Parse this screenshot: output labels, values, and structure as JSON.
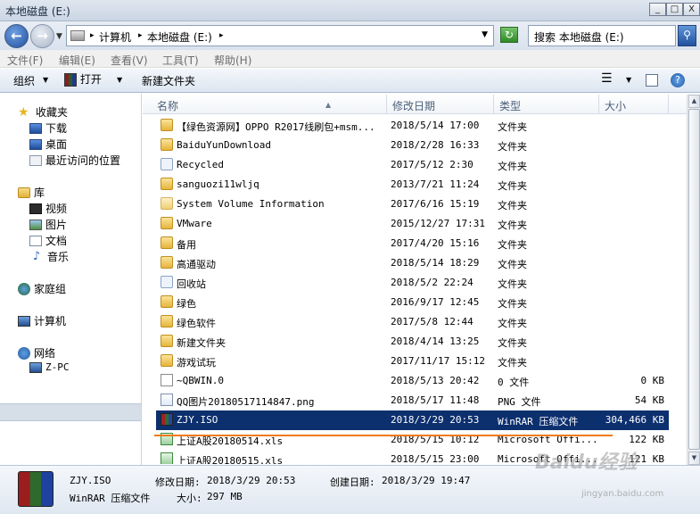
{
  "window": {
    "title": "本地磁盘 (E:)",
    "min": "_",
    "max": "□",
    "close": "X"
  },
  "address": {
    "crumbs": [
      "计算机",
      "本地磁盘 (E:)"
    ],
    "sep": "▸",
    "search_placeholder": "搜索 本地磁盘 (E:)"
  },
  "menu": [
    "文件(F)",
    "编辑(E)",
    "查看(V)",
    "工具(T)",
    "帮助(H)"
  ],
  "toolbar": {
    "organize": "组织",
    "open": "打开",
    "new_folder": "新建文件夹"
  },
  "nav": {
    "favorites": "收藏夹",
    "fav_items": [
      "下载",
      "桌面",
      "最近访问的位置"
    ],
    "libraries": "库",
    "lib_items": [
      "视频",
      "图片",
      "文档",
      "音乐"
    ],
    "homegroup": "家庭组",
    "computer": "计算机",
    "network": "网络",
    "network_items": [
      "Z-PC"
    ]
  },
  "columns": {
    "name": "名称",
    "modified": "修改日期",
    "type": "类型",
    "size": "大小"
  },
  "files": [
    {
      "name": "【绿色资源网】OPPO R2017线刷包+msm...",
      "date": "2018/5/14 17:00",
      "type": "文件夹",
      "size": "",
      "icon": "folder"
    },
    {
      "name": "BaiduYunDownload",
      "date": "2018/2/28 16:33",
      "type": "文件夹",
      "size": "",
      "icon": "folder"
    },
    {
      "name": "Recycled",
      "date": "2017/5/12 2:30",
      "type": "文件夹",
      "size": "",
      "icon": "recycle"
    },
    {
      "name": "sanguozi11wljq",
      "date": "2013/7/21 11:24",
      "type": "文件夹",
      "size": "",
      "icon": "folder"
    },
    {
      "name": "System Volume Information",
      "date": "2017/6/16 15:19",
      "type": "文件夹",
      "size": "",
      "icon": "folder-light"
    },
    {
      "name": "VMware",
      "date": "2015/12/27 17:31",
      "type": "文件夹",
      "size": "",
      "icon": "folder"
    },
    {
      "name": "备用",
      "date": "2017/4/20 15:16",
      "type": "文件夹",
      "size": "",
      "icon": "folder"
    },
    {
      "name": "高通驱动",
      "date": "2018/5/14 18:29",
      "type": "文件夹",
      "size": "",
      "icon": "folder"
    },
    {
      "name": "回收站",
      "date": "2018/5/2 22:24",
      "type": "文件夹",
      "size": "",
      "icon": "recycle"
    },
    {
      "name": "绿色",
      "date": "2016/9/17 12:45",
      "type": "文件夹",
      "size": "",
      "icon": "folder"
    },
    {
      "name": "绿色软件",
      "date": "2017/5/8 12:44",
      "type": "文件夹",
      "size": "",
      "icon": "folder"
    },
    {
      "name": "新建文件夹",
      "date": "2018/4/14 13:25",
      "type": "文件夹",
      "size": "",
      "icon": "folder"
    },
    {
      "name": "游戏试玩",
      "date": "2017/11/17 15:12",
      "type": "文件夹",
      "size": "",
      "icon": "folder"
    },
    {
      "name": "~QBWIN.0",
      "date": "2018/5/13 20:42",
      "type": "0 文件",
      "size": "0 KB",
      "icon": "file"
    },
    {
      "name": "QQ图片20180517114847.png",
      "date": "2018/5/17 11:48",
      "type": "PNG 文件",
      "size": "54 KB",
      "icon": "png"
    },
    {
      "name": "ZJY.ISO",
      "date": "2018/3/29 20:53",
      "type": "WinRAR 压缩文件",
      "size": "304,466 KB",
      "icon": "rar",
      "selected": true
    },
    {
      "name": "上证A股20180514.xls",
      "date": "2018/5/15 10:12",
      "type": "Microsoft Offi...",
      "size": "122 KB",
      "icon": "xls"
    },
    {
      "name": "上证A股20180515.xls",
      "date": "2018/5/15 23:00",
      "type": "Microsoft Offi...",
      "size": "121 KB",
      "icon": "xls"
    }
  ],
  "details": {
    "name": "ZJY.ISO",
    "type": "WinRAR 压缩文件",
    "modified_label": "修改日期:",
    "modified": "2018/3/29 20:53",
    "created_label": "创建日期:",
    "created": "2018/3/29 19:47",
    "size_label": "大小:",
    "size": "297 MB"
  },
  "watermark": {
    "main": "Baidu经验",
    "sub": "jingyan.baidu.com"
  }
}
